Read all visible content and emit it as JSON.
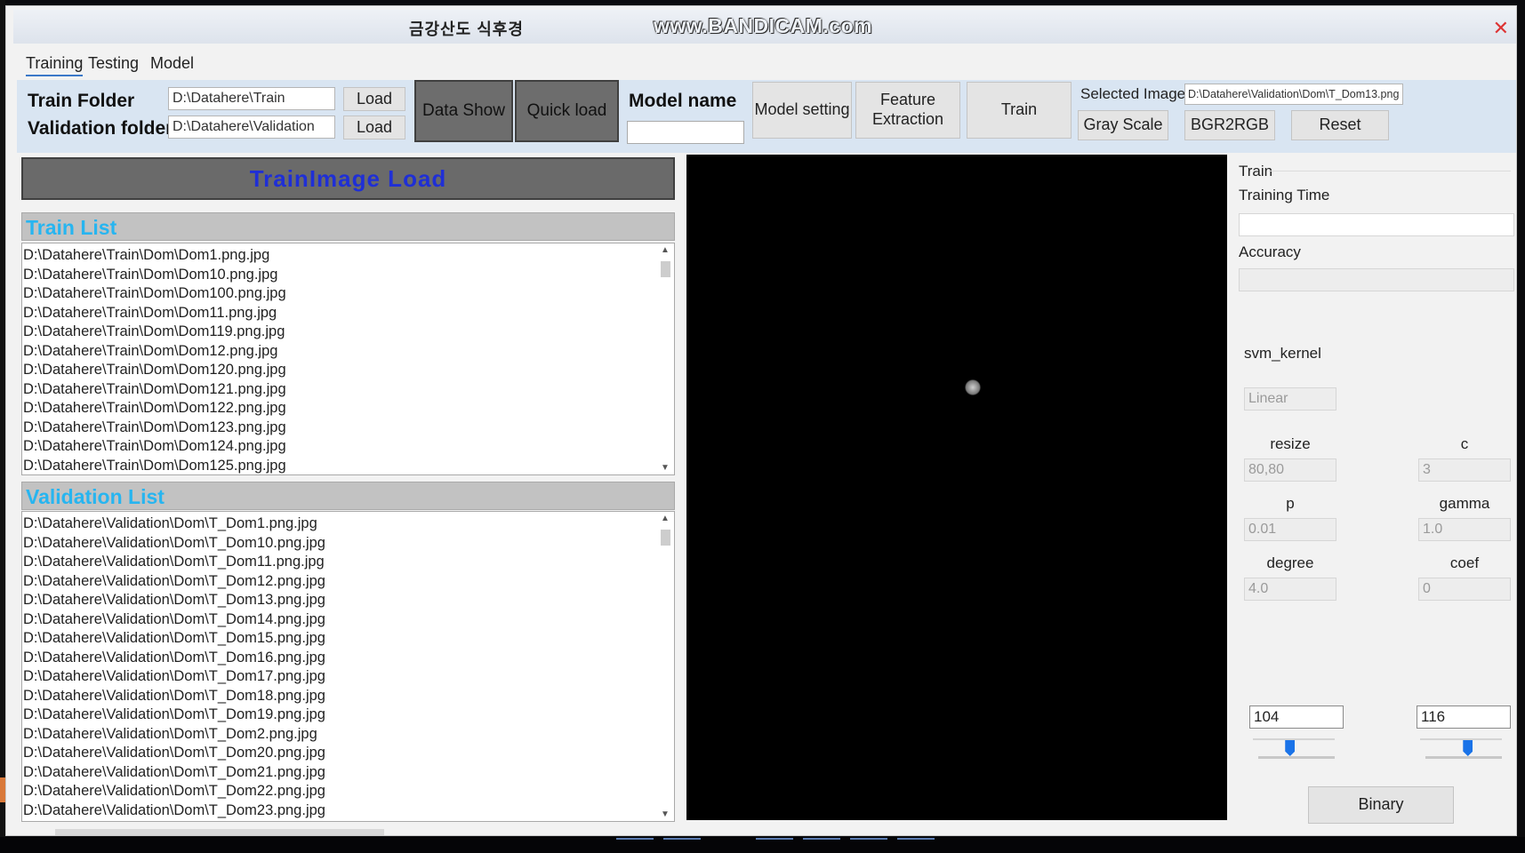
{
  "window": {
    "title": "금강산도 식후경",
    "watermark": "www.BANDICAM.com",
    "close_icon": "close-icon"
  },
  "menu": [
    "Training",
    "Testing",
    "Model"
  ],
  "toolbar": {
    "train_folder_label": "Train Folder",
    "train_folder_value": "D:\\Datahere\\Train",
    "validation_folder_label": "Validation folder",
    "validation_folder_value": "D:\\Datahere\\Validation",
    "load_label": "Load",
    "data_show_label": "Data Show",
    "quick_load_label": "Quick load",
    "model_name_label": "Model name",
    "model_name_value": "",
    "model_setting_label": "Model setting",
    "feature_extraction_label": "Feature Extraction",
    "train_label": "Train",
    "selected_image_label": "Selected Image",
    "selected_image_value": "D:\\Datahere\\Validation\\Dom\\T_Dom13.png",
    "gray_scale_label": "Gray Scale",
    "bgr2rgb_label": "BGR2RGB",
    "reset_label": "Reset"
  },
  "left": {
    "banner": "TrainImage  Load",
    "train_list_title": "Train List",
    "train_items": [
      "D:\\Datahere\\Train\\Dom\\Dom1.png.jpg",
      "D:\\Datahere\\Train\\Dom\\Dom10.png.jpg",
      "D:\\Datahere\\Train\\Dom\\Dom100.png.jpg",
      "D:\\Datahere\\Train\\Dom\\Dom11.png.jpg",
      "D:\\Datahere\\Train\\Dom\\Dom119.png.jpg",
      "D:\\Datahere\\Train\\Dom\\Dom12.png.jpg",
      "D:\\Datahere\\Train\\Dom\\Dom120.png.jpg",
      "D:\\Datahere\\Train\\Dom\\Dom121.png.jpg",
      "D:\\Datahere\\Train\\Dom\\Dom122.png.jpg",
      "D:\\Datahere\\Train\\Dom\\Dom123.png.jpg",
      "D:\\Datahere\\Train\\Dom\\Dom124.png.jpg",
      "D:\\Datahere\\Train\\Dom\\Dom125.png.jpg"
    ],
    "validation_list_title": "Validation List",
    "validation_items": [
      "D:\\Datahere\\Validation\\Dom\\T_Dom1.png.jpg",
      "D:\\Datahere\\Validation\\Dom\\T_Dom10.png.jpg",
      "D:\\Datahere\\Validation\\Dom\\T_Dom11.png.jpg",
      "D:\\Datahere\\Validation\\Dom\\T_Dom12.png.jpg",
      "D:\\Datahere\\Validation\\Dom\\T_Dom13.png.jpg",
      "D:\\Datahere\\Validation\\Dom\\T_Dom14.png.jpg",
      "D:\\Datahere\\Validation\\Dom\\T_Dom15.png.jpg",
      "D:\\Datahere\\Validation\\Dom\\T_Dom16.png.jpg",
      "D:\\Datahere\\Validation\\Dom\\T_Dom17.png.jpg",
      "D:\\Datahere\\Validation\\Dom\\T_Dom18.png.jpg",
      "D:\\Datahere\\Validation\\Dom\\T_Dom19.png.jpg",
      "D:\\Datahere\\Validation\\Dom\\T_Dom2.png.jpg",
      "D:\\Datahere\\Validation\\Dom\\T_Dom20.png.jpg",
      "D:\\Datahere\\Validation\\Dom\\T_Dom21.png.jpg",
      "D:\\Datahere\\Validation\\Dom\\T_Dom22.png.jpg",
      "D:\\Datahere\\Validation\\Dom\\T_Dom23.png.jpg"
    ]
  },
  "right": {
    "group_title": "Train",
    "training_time_label": "Training Time",
    "training_time_value": "",
    "accuracy_label": "Accuracy",
    "accuracy_value": "",
    "svm_kernel_label": "svm_kernel",
    "svm_kernel_value": "Linear",
    "resize_label": "resize",
    "resize_value": "80,80",
    "c_label": "c",
    "c_value": "3",
    "p_label": "p",
    "p_value": "0.01",
    "gamma_label": "gamma",
    "gamma_value": "1.0",
    "degree_label": "degree",
    "degree_value": "4.0",
    "coef_label": "coef",
    "coef_value": "0",
    "threshold_low_value": "104",
    "threshold_high_value": "116",
    "threshold_low_level": 0.41,
    "threshold_high_level": 0.55,
    "binary_label": "Binary"
  },
  "colors": {
    "list_title": "#27b5f0",
    "banner_text": "#1f2fd6",
    "toolbar_bg": "#d9e5f2",
    "slider_thumb": "#1a73e8",
    "close": "#dd3333"
  }
}
